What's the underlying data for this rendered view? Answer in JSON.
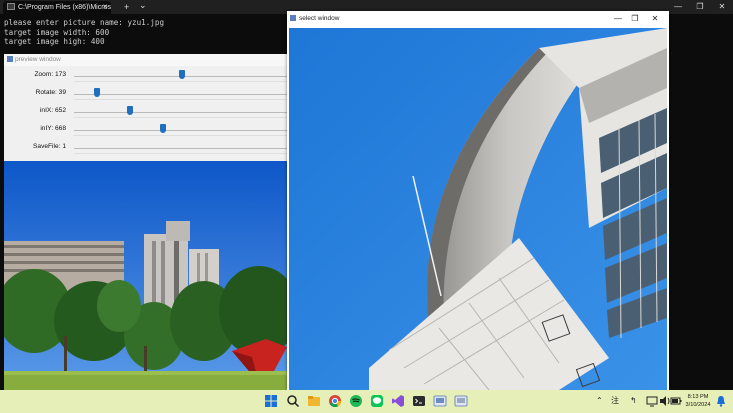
{
  "terminal": {
    "tab_title": "C:\\Program Files (x86)\\Micros",
    "close_glyph": "✕",
    "new_tab_glyph": "+",
    "dropdown_glyph": "⌄",
    "lines": [
      "please enter picture name: yzu1.jpg",
      "target image width: 600",
      "target image high: 400"
    ]
  },
  "preview_window": {
    "title": "preview window",
    "trackbars": [
      {
        "label": "Zoom: 173",
        "value": 173,
        "max": 340
      },
      {
        "label": "Rotate: 39",
        "value": 39,
        "max": 360
      },
      {
        "label": "inIX: 652",
        "value": 652,
        "max": 2500
      },
      {
        "label": "inIY: 668",
        "value": 668,
        "max": 1600
      },
      {
        "label": "SaveFile: 1",
        "value": 1,
        "max": 1
      }
    ]
  },
  "select_window": {
    "title": "select window"
  },
  "taskbar": {
    "time": "8:13 PM",
    "date": "3/10/2024"
  }
}
